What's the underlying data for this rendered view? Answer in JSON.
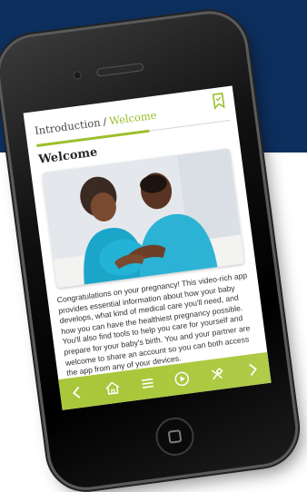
{
  "breadcrumb": {
    "parent": "Introduction",
    "separator": "/",
    "current": "Welcome"
  },
  "page": {
    "title": "Welcome"
  },
  "photo": {
    "alt": "Couple smiling together"
  },
  "body": {
    "text": "Congratulations on your pregnancy! This video-rich app provides essential information about how your baby develops, what kind of medical care you'll need, and how you can have the healthiest pregnancy possible. You'll also find tools to help you care for yourself and prepare for your baby's birth. You and your partner are welcome to share an account so you can both access the app from any of your devices."
  },
  "icons": {
    "bookmark": "bookmark-icon",
    "prev": "chevron-left-icon",
    "home": "home-icon",
    "menu": "menu-icon",
    "play": "play-icon",
    "tools": "tools-icon",
    "next": "chevron-right-icon"
  },
  "colors": {
    "accent": "#9cbf2c",
    "nav_bar": "#a9c73a",
    "background_band": "#0d2f5e"
  }
}
